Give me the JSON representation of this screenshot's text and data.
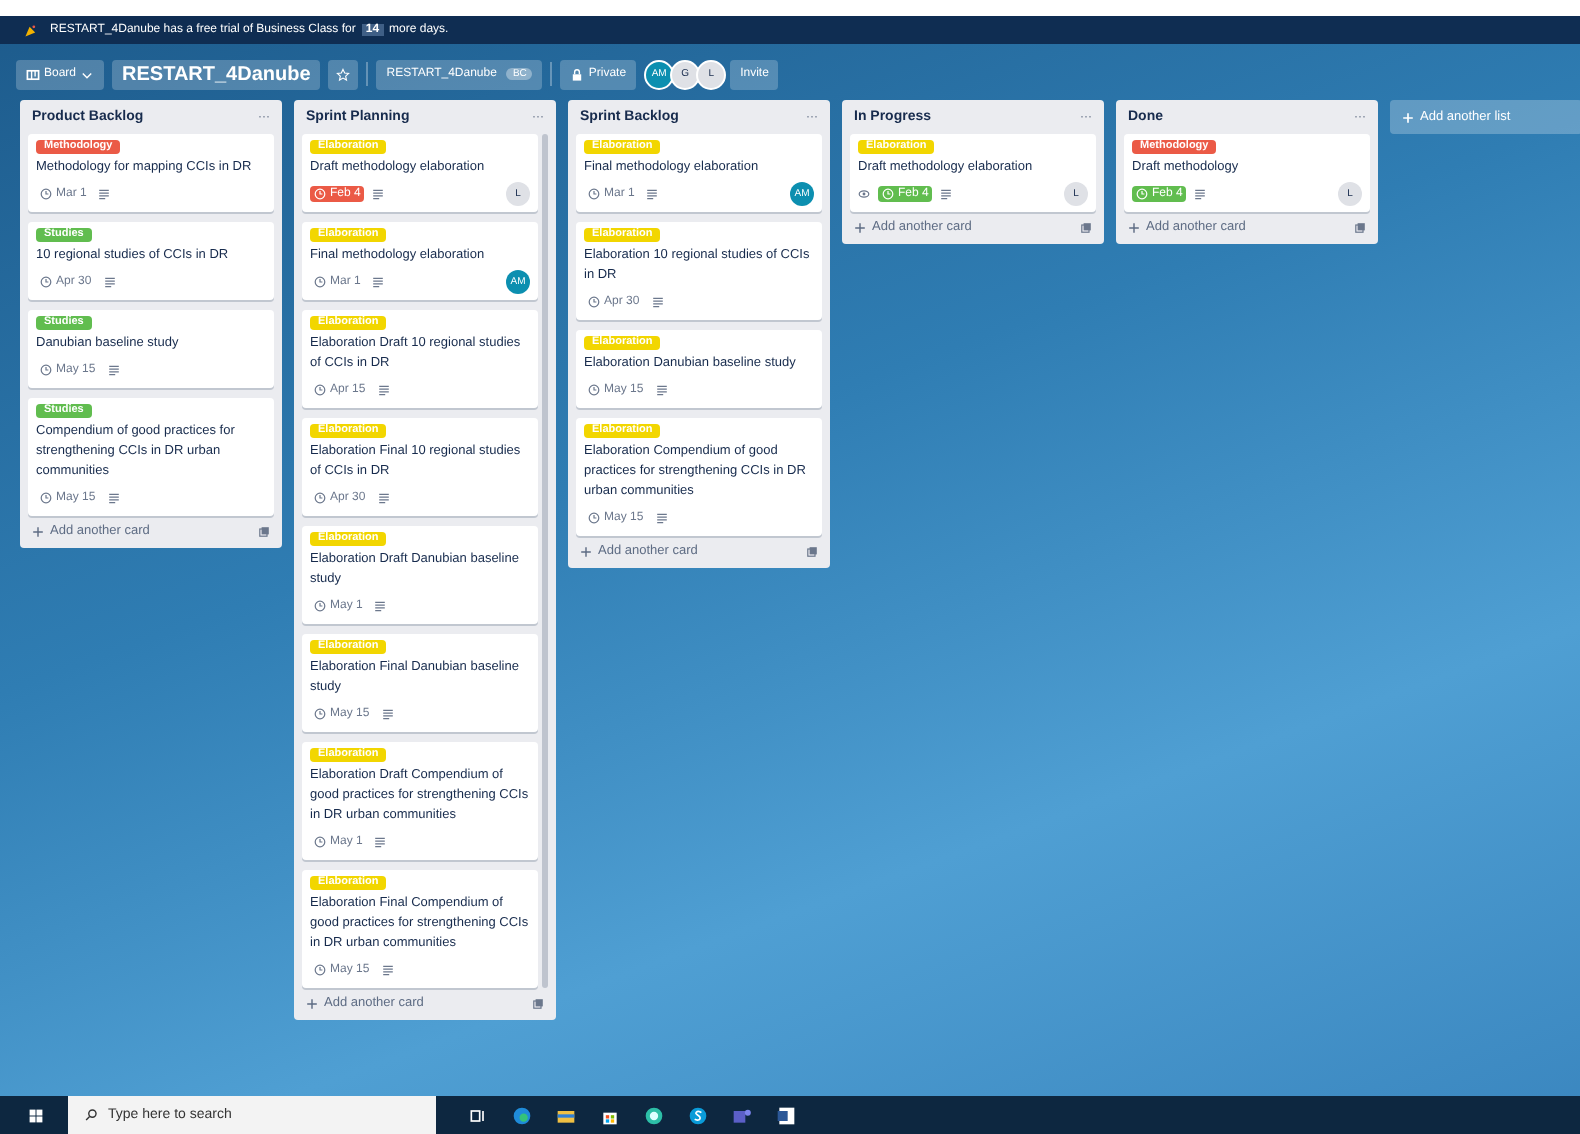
{
  "banner": {
    "text_before": "RESTART_4Danube has a free trial of Business Class for",
    "days": "14",
    "text_after": "more days."
  },
  "header": {
    "board_menu": "Board",
    "board_title": "RESTART_4Danube",
    "team": "RESTART_4Danube",
    "team_badge": "BC",
    "visibility": "Private",
    "members": [
      {
        "initials": "AM",
        "color": "#0c8fb0"
      },
      {
        "initials": "G",
        "color": "#dfe1e6"
      },
      {
        "initials": "L",
        "color": "#dfe1e6"
      }
    ],
    "invite": "Invite"
  },
  "lists": [
    {
      "title": "Product Backlog",
      "menu": "···",
      "add_card": "Add another card",
      "cards": [
        {
          "label": {
            "text": "Methodology",
            "color": "#eb5a46"
          },
          "title": "Methodology for mapping CCIs in DR",
          "due": "Mar 1",
          "overdue": false,
          "complete": false,
          "watching": false
        },
        {
          "label": {
            "text": "Studies",
            "color": "#61bd4f"
          },
          "title": "10 regional studies of CCIs in DR",
          "due": "Apr 30",
          "overdue": false,
          "complete": false,
          "watching": false
        },
        {
          "label": {
            "text": "Studies",
            "color": "#61bd4f"
          },
          "title": "Danubian baseline study",
          "due": "May 15",
          "overdue": false,
          "complete": false,
          "watching": false
        },
        {
          "label": {
            "text": "Studies",
            "color": "#61bd4f"
          },
          "title": "Compendium of good practices for strengthening CCIs in DR urban communities",
          "due": "May 15",
          "overdue": false,
          "complete": false,
          "watching": false
        }
      ]
    },
    {
      "title": "Sprint Planning",
      "menu": "···",
      "add_card": "Add another card",
      "cards": [
        {
          "label": {
            "text": "Elaboration",
            "color": "#f2d600"
          },
          "title": "Draft methodology elaboration",
          "due": "Feb 4",
          "overdue": true,
          "complete": false,
          "watching": false,
          "member": {
            "initials": "L",
            "color": "#dfe1e6"
          }
        },
        {
          "label": {
            "text": "Elaboration",
            "color": "#f2d600"
          },
          "title": "Final methodology elaboration",
          "due": "Mar 1",
          "overdue": false,
          "complete": false,
          "watching": false,
          "member": {
            "initials": "AM",
            "color": "#0c8fb0"
          }
        },
        {
          "label": {
            "text": "Elaboration",
            "color": "#f2d600"
          },
          "title": "Elaboration Draft 10 regional studies of CCIs in DR",
          "due": "Apr 15",
          "overdue": false,
          "complete": false,
          "watching": false
        },
        {
          "label": {
            "text": "Elaboration",
            "color": "#f2d600"
          },
          "title": "Elaboration Final 10 regional studies of CCIs in DR",
          "due": "Apr 30",
          "overdue": false,
          "complete": false,
          "watching": false
        },
        {
          "label": {
            "text": "Elaboration",
            "color": "#f2d600"
          },
          "title": "Elaboration Draft Danubian baseline study",
          "due": "May 1",
          "overdue": false,
          "complete": false,
          "watching": false
        },
        {
          "label": {
            "text": "Elaboration",
            "color": "#f2d600"
          },
          "title": "Elaboration Final Danubian baseline study",
          "due": "May 15",
          "overdue": false,
          "complete": false,
          "watching": false
        },
        {
          "label": {
            "text": "Elaboration",
            "color": "#f2d600"
          },
          "title": "Elaboration Draft Compendium of good practices for strengthening CCIs in DR urban communities",
          "due": "May 1",
          "overdue": false,
          "complete": false,
          "watching": false
        },
        {
          "label": {
            "text": "Elaboration",
            "color": "#f2d600"
          },
          "title": "Elaboration Final Compendium of good practices for strengthening CCIs in DR urban communities",
          "due": "May 15",
          "overdue": false,
          "complete": false,
          "watching": false
        }
      ]
    },
    {
      "title": "Sprint Backlog",
      "menu": "···",
      "add_card": "Add another card",
      "cards": [
        {
          "label": {
            "text": "Elaboration",
            "color": "#f2d600"
          },
          "title": "Final methodology elaboration",
          "due": "Mar 1",
          "overdue": false,
          "complete": false,
          "watching": false,
          "member": {
            "initials": "AM",
            "color": "#0c8fb0"
          }
        },
        {
          "label": {
            "text": "Elaboration",
            "color": "#f2d600"
          },
          "title": "Elaboration 10 regional studies of CCIs in DR",
          "due": "Apr 30",
          "overdue": false,
          "complete": false,
          "watching": false
        },
        {
          "label": {
            "text": "Elaboration",
            "color": "#f2d600"
          },
          "title": "Elaboration Danubian baseline study",
          "due": "May 15",
          "overdue": false,
          "complete": false,
          "watching": false
        },
        {
          "label": {
            "text": "Elaboration",
            "color": "#f2d600"
          },
          "title": "Elaboration Compendium of good practices for strengthening CCIs in DR urban communities",
          "due": "May 15",
          "overdue": false,
          "complete": false,
          "watching": false
        }
      ]
    },
    {
      "title": "In Progress",
      "menu": "···",
      "add_card": "Add another card",
      "cards": [
        {
          "label": {
            "text": "Elaboration",
            "color": "#f2d600"
          },
          "title": "Draft methodology elaboration",
          "due": "Feb 4",
          "overdue": false,
          "complete": true,
          "watching": true,
          "member": {
            "initials": "L",
            "color": "#dfe1e6"
          }
        }
      ]
    },
    {
      "title": "Done",
      "menu": "···",
      "add_card": "Add another card",
      "cards": [
        {
          "label": {
            "text": "Methodology",
            "color": "#eb5a46"
          },
          "title": "Draft methodology",
          "due": "Feb 4",
          "overdue": false,
          "complete": true,
          "watching": false,
          "member": {
            "initials": "L",
            "color": "#dfe1e6"
          }
        }
      ]
    }
  ],
  "add_list": "Add another list",
  "taskbar": {
    "search_placeholder": "Type here to search"
  }
}
